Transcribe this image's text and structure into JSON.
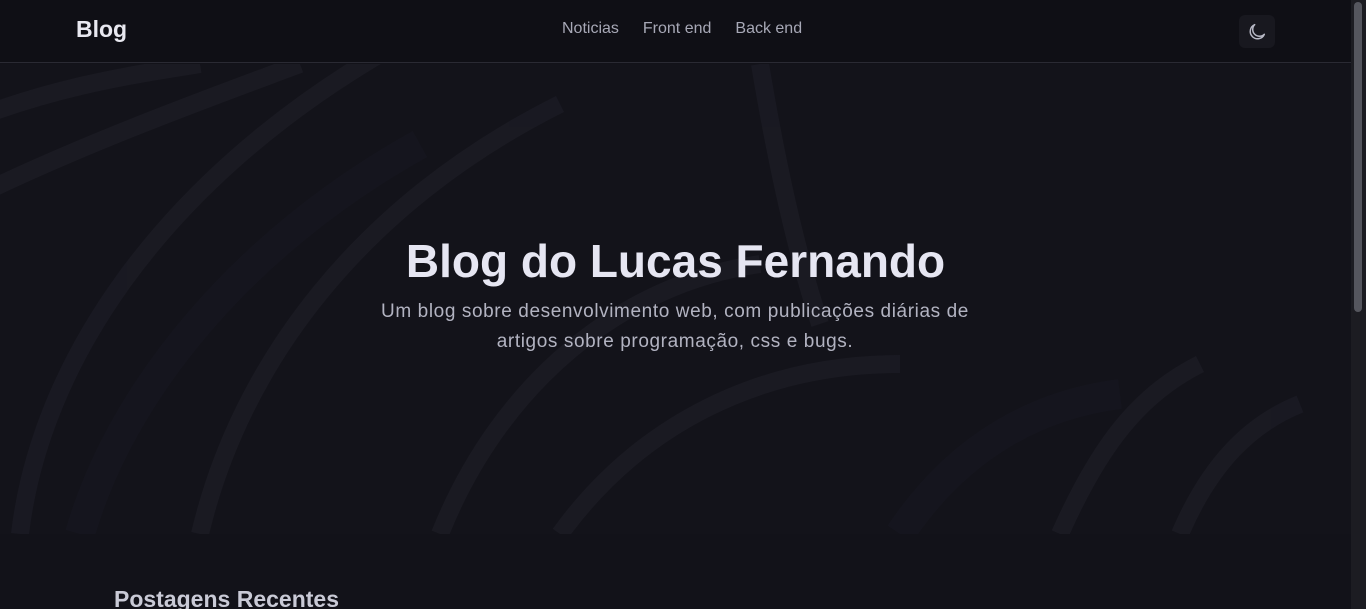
{
  "header": {
    "brand": "Blog",
    "nav": [
      {
        "label": "Noticias"
      },
      {
        "label": "Front end"
      },
      {
        "label": "Back end"
      }
    ],
    "theme_toggle_icon": "moon-icon"
  },
  "hero": {
    "title": "Blog do Lucas Fernando",
    "subtitle": "Um blog sobre desenvolvimento web, com publicações diárias de artigos sobre programação, css e bugs."
  },
  "main": {
    "section_title": "Postagens Recentes"
  },
  "colors": {
    "background": "#121219",
    "header_bg": "#0f0f15",
    "title": "#e6e6f2",
    "text_muted": "#a7a8b6"
  }
}
